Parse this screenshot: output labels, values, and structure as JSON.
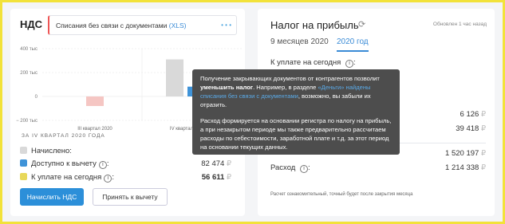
{
  "left_card": {
    "title": "НДС",
    "tab_text": "Списания без связи с документами",
    "tab_xls": "(XLS)",
    "dots": "• • •",
    "quarter_heading": "За IV квартал 2020 года",
    "rows": [
      {
        "label": "Начислено:",
        "value": ""
      },
      {
        "label": "Доступно к вычету",
        "value": "82 474"
      },
      {
        "label": "К уплате на сегодня",
        "value": "56 611"
      }
    ],
    "currency": "₽",
    "btn_calc": "Начислить НДС",
    "btn_accept": "Принять к вычету",
    "colors": {
      "accrued": "#d9d9d9",
      "deduct": "#3f93d8",
      "pay": "#e8d85a",
      "negative": "#f5c6c3"
    }
  },
  "chart_data": {
    "type": "bar",
    "categories": [
      "III квартал 2020",
      "IV квартал 2020"
    ],
    "yticks": [
      "400 тыс",
      "200 тыс",
      "0",
      "− 200 тыс"
    ],
    "ylim": [
      -200,
      400
    ],
    "series": [
      {
        "values": [
          -80,
          310
        ]
      },
      {
        "values": [
          null,
          82
        ]
      }
    ]
  },
  "right_card": {
    "title": "Налог на прибыль",
    "refresh_icon": "refresh-icon",
    "updated": "Обновлен 1 час назад",
    "period_1": "9 месяцев 2020",
    "period_2": "2020 год",
    "pay_today_label": "К уплате на сегодня",
    "values": [
      {
        "label": "",
        "value": "6 126"
      },
      {
        "label": "",
        "value": "39 418"
      },
      {
        "label": "",
        "value": "1 520 197"
      },
      {
        "label": "Расход",
        "value": "1 214 338"
      }
    ],
    "currency": "₽",
    "footnote": "Расчет ознакомительный, точный будет после закрытия месяца"
  },
  "tooltip": {
    "p1_a": "Получение закрывающих документов от контрагентов позволит ",
    "p1_b": "уменьшить налог",
    "p1_c": ". Например, в разделе ",
    "p1_link": "«Деньги» найдены списания без связи с документами",
    "p1_d": ", возможно, вы забыли их отразить.",
    "p2": "Расход формируется на основании регистра по налогу на прибыль, а при незакрытом периоде мы также предварительно рассчитаем расходы по себестоимости, заработной плате и т.д. за этот период на основании текущих данных."
  }
}
